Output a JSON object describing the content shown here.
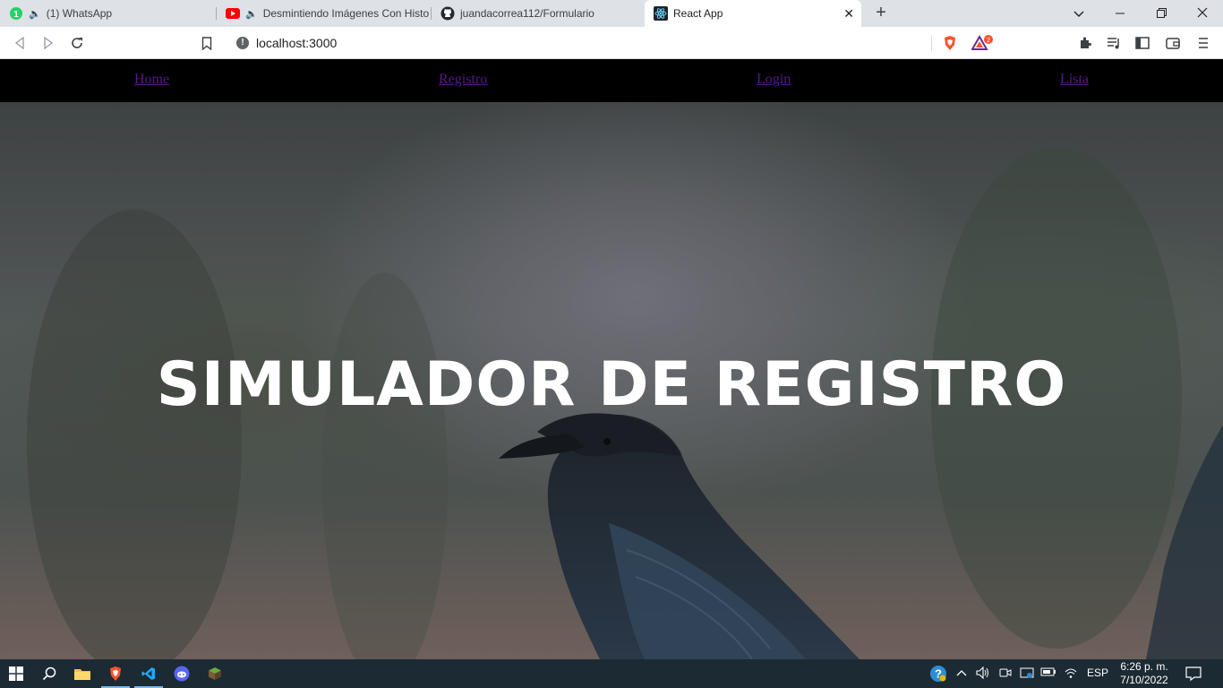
{
  "browser": {
    "tabs": [
      {
        "title": "(1) WhatsApp",
        "badge": "1"
      },
      {
        "title": "Desmintiendo Imágenes Con Histo"
      },
      {
        "title": "juandacorrea112/Formulario"
      },
      {
        "title": "React App"
      }
    ],
    "address": "localhost:3000",
    "brave_badge": "2"
  },
  "page": {
    "nav": {
      "home": "Home",
      "registro": "Registro",
      "login": "Login",
      "lista": "Lista"
    },
    "hero_title": "SIMULADOR DE REGISTRO",
    "colors": {
      "nav_bg": "#000000",
      "link": "#551a8b",
      "title": "#ffffff"
    }
  },
  "taskbar": {
    "language": "ESP",
    "time": "6:26 p. m.",
    "date": "7/10/2022"
  }
}
